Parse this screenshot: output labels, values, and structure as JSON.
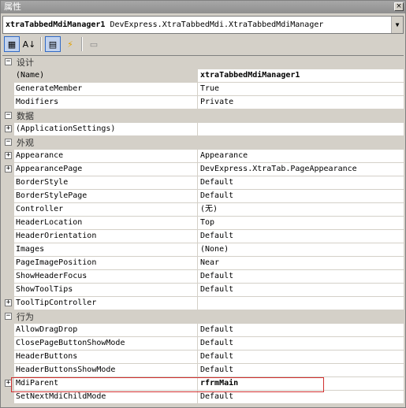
{
  "window": {
    "title": "属性",
    "close_label": "×"
  },
  "selector": {
    "object_name": "xtraTabbedMdiManager1",
    "object_type": "DevExpress.XtraTabbedMdi.XtraTabbedMdiManager",
    "dropdown_glyph": "▼"
  },
  "toolbar": {
    "categorized_glyph": "▦",
    "alphabetical_glyph": "A↓",
    "properties_glyph": "▤",
    "events_glyph": "⚡",
    "pages_glyph": "▭"
  },
  "grid": {
    "categories": [
      {
        "label": "设计",
        "expander": "−",
        "rows": [
          {
            "name": "(Name)",
            "value": "xtraTabbedMdiManager1",
            "bold": true,
            "expandable": false,
            "selected": true
          },
          {
            "name": "GenerateMember",
            "value": "True",
            "expandable": false
          },
          {
            "name": "Modifiers",
            "value": "Private",
            "expandable": false
          }
        ]
      },
      {
        "label": "数据",
        "expander": "−",
        "rows": [
          {
            "name": "(ApplicationSettings)",
            "value": "",
            "expandable": true
          }
        ]
      },
      {
        "label": "外观",
        "expander": "−",
        "rows": [
          {
            "name": "Appearance",
            "value": "Appearance",
            "expandable": true
          },
          {
            "name": "AppearancePage",
            "value": "DevExpress.XtraTab.PageAppearance",
            "expandable": true
          },
          {
            "name": "BorderStyle",
            "value": "Default",
            "expandable": false
          },
          {
            "name": "BorderStylePage",
            "value": "Default",
            "expandable": false
          },
          {
            "name": "Controller",
            "value": "(无)",
            "expandable": false
          },
          {
            "name": "HeaderLocation",
            "value": "Top",
            "expandable": false
          },
          {
            "name": "HeaderOrientation",
            "value": "Default",
            "expandable": false
          },
          {
            "name": "Images",
            "value": "(None)",
            "expandable": false
          },
          {
            "name": "PageImagePosition",
            "value": "Near",
            "expandable": false
          },
          {
            "name": "ShowHeaderFocus",
            "value": "Default",
            "expandable": false
          },
          {
            "name": "ShowToolTips",
            "value": "Default",
            "expandable": false
          },
          {
            "name": "ToolTipController",
            "value": "",
            "expandable": true
          }
        ]
      },
      {
        "label": "行为",
        "expander": "−",
        "rows": [
          {
            "name": "AllowDragDrop",
            "value": "Default",
            "expandable": false
          },
          {
            "name": "ClosePageButtonShowMode",
            "value": "Default",
            "expandable": false
          },
          {
            "name": "HeaderButtons",
            "value": "Default",
            "expandable": false
          },
          {
            "name": "HeaderButtonsShowMode",
            "value": "Default",
            "expandable": false
          },
          {
            "name": "MdiParent",
            "value": "rfrmMain",
            "bold": true,
            "expandable": true
          },
          {
            "name": "SetNextMdiChildMode",
            "value": "Default",
            "expandable": false
          }
        ]
      }
    ],
    "row_expand_glyph": "+"
  },
  "colors": {
    "highlight": "#d03030",
    "selection": "#316ac5"
  }
}
